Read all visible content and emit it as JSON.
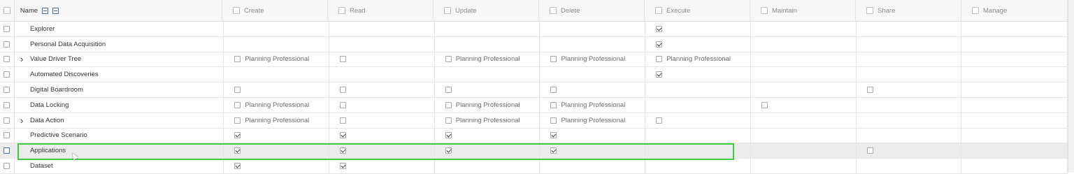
{
  "header": {
    "name": "Name",
    "columns": [
      "Create",
      "Read",
      "Update",
      "Delete",
      "Execute",
      "Maintain",
      "Share",
      "Manage"
    ]
  },
  "rows": [
    {
      "name": "Explorer",
      "expandable": false,
      "selected": false,
      "cells": [
        null,
        null,
        null,
        null,
        {
          "checked": true,
          "label": ""
        },
        null,
        null,
        null
      ]
    },
    {
      "name": "Personal Data Acquisition",
      "expandable": false,
      "selected": false,
      "cells": [
        null,
        null,
        null,
        null,
        {
          "checked": true,
          "label": ""
        },
        null,
        null,
        null
      ]
    },
    {
      "name": "Value Driver Tree",
      "expandable": true,
      "selected": false,
      "cells": [
        {
          "checked": false,
          "label": "Planning Professional"
        },
        {
          "checked": false,
          "label": ""
        },
        {
          "checked": false,
          "label": "Planning Professional"
        },
        {
          "checked": false,
          "label": "Planning Professional"
        },
        {
          "checked": false,
          "label": "Planning Professional"
        },
        null,
        null,
        null
      ]
    },
    {
      "name": "Automated Discoveries",
      "expandable": false,
      "selected": false,
      "cells": [
        null,
        null,
        null,
        null,
        {
          "checked": true,
          "label": ""
        },
        null,
        null,
        null
      ]
    },
    {
      "name": "Digital Boardroom",
      "expandable": false,
      "selected": false,
      "cells": [
        {
          "checked": false,
          "label": ""
        },
        {
          "checked": false,
          "label": ""
        },
        {
          "checked": false,
          "label": ""
        },
        {
          "checked": false,
          "label": ""
        },
        null,
        null,
        {
          "checked": false,
          "label": ""
        },
        null
      ]
    },
    {
      "name": "Data Locking",
      "expandable": false,
      "selected": false,
      "cells": [
        {
          "checked": false,
          "label": "Planning Professional"
        },
        {
          "checked": false,
          "label": ""
        },
        {
          "checked": false,
          "label": "Planning Professional"
        },
        {
          "checked": false,
          "label": "Planning Professional"
        },
        null,
        {
          "checked": false,
          "label": ""
        },
        null,
        null
      ]
    },
    {
      "name": "Data Action",
      "expandable": true,
      "selected": false,
      "cells": [
        {
          "checked": false,
          "label": "Planning Professional"
        },
        {
          "checked": false,
          "label": ""
        },
        {
          "checked": false,
          "label": "Planning Professional"
        },
        {
          "checked": false,
          "label": "Planning Professional"
        },
        {
          "checked": false,
          "label": ""
        },
        null,
        null,
        null
      ]
    },
    {
      "name": "Predictive Scenario",
      "expandable": false,
      "selected": false,
      "cells": [
        {
          "checked": true,
          "label": ""
        },
        {
          "checked": true,
          "label": ""
        },
        {
          "checked": true,
          "label": ""
        },
        {
          "checked": true,
          "label": ""
        },
        null,
        null,
        null,
        null
      ]
    },
    {
      "name": "Applications",
      "expandable": false,
      "selected": true,
      "cells": [
        {
          "checked": true,
          "label": ""
        },
        {
          "checked": true,
          "label": ""
        },
        {
          "checked": true,
          "label": ""
        },
        {
          "checked": true,
          "label": ""
        },
        null,
        null,
        {
          "checked": false,
          "label": ""
        },
        null
      ]
    },
    {
      "name": "Dataset",
      "expandable": false,
      "selected": false,
      "cells": [
        {
          "checked": true,
          "label": ""
        },
        {
          "checked": true,
          "label": ""
        },
        null,
        null,
        null,
        null,
        null,
        null
      ]
    }
  ],
  "colors": {
    "highlight": "#3dcc3d",
    "checkbox_border": "#a9a9a9",
    "selected_row": "#ececec"
  },
  "icons": {
    "expand": "chevron-right-icon",
    "header_actions": [
      "expand-all-icon",
      "collapse-all-icon"
    ]
  }
}
